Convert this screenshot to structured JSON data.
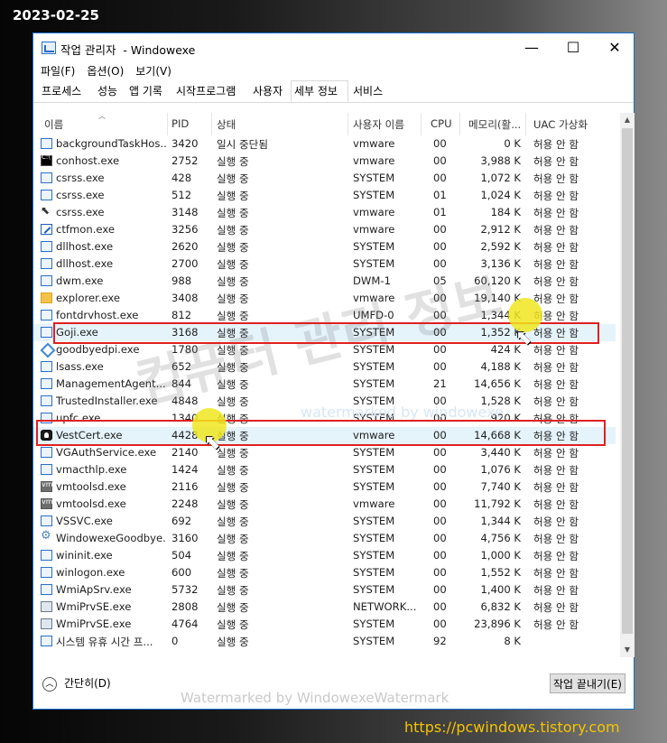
{
  "overlay": {
    "date": "2023-02-25",
    "site_url": "https://pcwindows.tistory.com",
    "watermark_bottom": "Watermarked by WindowexeWatermark",
    "watermark_center": "watermarked by windowexe",
    "watermark_big": "컴퓨터 관리 정보"
  },
  "window": {
    "title": "작업 관리자  - Windowexe",
    "controls": {
      "minimize": "—",
      "maximize": "☐",
      "close": "✕"
    }
  },
  "menu": [
    "파일(F)",
    "옵션(O)",
    "보기(V)"
  ],
  "tabs": [
    "프로세스",
    "성능",
    "앱 기록",
    "시작프로그램",
    "사용자",
    "세부 정보",
    "서비스"
  ],
  "active_tab": "세부 정보",
  "columns": [
    "이름",
    "PID",
    "상태",
    "사용자 이름",
    "CPU",
    "메모리(활...",
    "UAC 가상화"
  ],
  "rows": [
    {
      "icon": "box",
      "name": "backgroundTaskHos...",
      "pid": "3420",
      "status": "일시 중단됨",
      "user": "vmware",
      "cpu": "00",
      "mem": "0 K",
      "uac": "허용 안 함"
    },
    {
      "icon": "console",
      "name": "conhost.exe",
      "pid": "2752",
      "status": "실행 중",
      "user": "vmware",
      "cpu": "00",
      "mem": "3,988 K",
      "uac": "허용 안 함"
    },
    {
      "icon": "box",
      "name": "csrss.exe",
      "pid": "428",
      "status": "실행 중",
      "user": "SYSTEM",
      "cpu": "00",
      "mem": "1,072 K",
      "uac": "허용 안 함"
    },
    {
      "icon": "box",
      "name": "csrss.exe",
      "pid": "512",
      "status": "실행 중",
      "user": "SYSTEM",
      "cpu": "01",
      "mem": "1,024 K",
      "uac": "허용 안 함"
    },
    {
      "icon": "cursor",
      "name": "csrss.exe",
      "pid": "3148",
      "status": "실행 중",
      "user": "vmware",
      "cpu": "01",
      "mem": "184 K",
      "uac": "허용 안 함"
    },
    {
      "icon": "pen",
      "name": "ctfmon.exe",
      "pid": "3256",
      "status": "실행 중",
      "user": "vmware",
      "cpu": "00",
      "mem": "2,912 K",
      "uac": "허용 안 함"
    },
    {
      "icon": "box",
      "name": "dllhost.exe",
      "pid": "2620",
      "status": "실행 중",
      "user": "SYSTEM",
      "cpu": "00",
      "mem": "2,592 K",
      "uac": "허용 안 함"
    },
    {
      "icon": "box",
      "name": "dllhost.exe",
      "pid": "2700",
      "status": "실행 중",
      "user": "SYSTEM",
      "cpu": "00",
      "mem": "3,136 K",
      "uac": "허용 안 함"
    },
    {
      "icon": "box",
      "name": "dwm.exe",
      "pid": "988",
      "status": "실행 중",
      "user": "DWM-1",
      "cpu": "05",
      "mem": "60,120 K",
      "uac": "허용 안 함"
    },
    {
      "icon": "folder",
      "name": "explorer.exe",
      "pid": "3408",
      "status": "실행 중",
      "user": "vmware",
      "cpu": "00",
      "mem": "19,140 K",
      "uac": "허용 안 함"
    },
    {
      "icon": "box",
      "name": "fontdrvhost.exe",
      "pid": "812",
      "status": "실행 중",
      "user": "UMFD-0",
      "cpu": "00",
      "mem": "1,344 K",
      "uac": "허용 안 함"
    },
    {
      "icon": "box",
      "name": "Goji.exe",
      "pid": "3168",
      "status": "실행 중",
      "user": "SYSTEM",
      "cpu": "00",
      "mem": "1,352 K",
      "uac": "허용 안 함",
      "selected": true
    },
    {
      "icon": "diamond",
      "name": "goodbyedpi.exe",
      "pid": "1780",
      "status": "실행 중",
      "user": "SYSTEM",
      "cpu": "00",
      "mem": "424 K",
      "uac": "허용 안 함"
    },
    {
      "icon": "box",
      "name": "lsass.exe",
      "pid": "652",
      "status": "실행 중",
      "user": "SYSTEM",
      "cpu": "00",
      "mem": "4,188 K",
      "uac": "허용 안 함"
    },
    {
      "icon": "box",
      "name": "ManagementAgent...",
      "pid": "844",
      "status": "실행 중",
      "user": "SYSTEM",
      "cpu": "21",
      "mem": "14,656 K",
      "uac": "허용 안 함"
    },
    {
      "icon": "box",
      "name": "TrustedInstaller.exe",
      "pid": "4848",
      "status": "실행 중",
      "user": "SYSTEM",
      "cpu": "00",
      "mem": "1,528 K",
      "uac": "허용 안 함"
    },
    {
      "icon": "box",
      "name": "upfc.exe",
      "pid": "1340",
      "status": "실행 중",
      "user": "SYSTEM",
      "cpu": "00",
      "mem": "920 K",
      "uac": "허용 안 함"
    },
    {
      "icon": "vestcert",
      "name": "VestCert.exe",
      "pid": "4428",
      "status": "실행 중",
      "user": "vmware",
      "cpu": "00",
      "mem": "14,668 K",
      "uac": "허용 안 함",
      "selected": true
    },
    {
      "icon": "box",
      "name": "VGAuthService.exe",
      "pid": "2140",
      "status": "실행 중",
      "user": "SYSTEM",
      "cpu": "00",
      "mem": "3,440 K",
      "uac": "허용 안 함"
    },
    {
      "icon": "box",
      "name": "vmacthlp.exe",
      "pid": "1424",
      "status": "실행 중",
      "user": "SYSTEM",
      "cpu": "00",
      "mem": "1,076 K",
      "uac": "허용 안 함"
    },
    {
      "icon": "vm",
      "name": "vmtoolsd.exe",
      "pid": "2116",
      "status": "실행 중",
      "user": "SYSTEM",
      "cpu": "00",
      "mem": "7,740 K",
      "uac": "허용 안 함"
    },
    {
      "icon": "vm",
      "name": "vmtoolsd.exe",
      "pid": "2248",
      "status": "실행 중",
      "user": "vmware",
      "cpu": "00",
      "mem": "11,792 K",
      "uac": "허용 안 함"
    },
    {
      "icon": "box",
      "name": "VSSVC.exe",
      "pid": "692",
      "status": "실행 중",
      "user": "SYSTEM",
      "cpu": "00",
      "mem": "1,344 K",
      "uac": "허용 안 함"
    },
    {
      "icon": "gear",
      "name": "WindowexeGoodbye...",
      "pid": "3160",
      "status": "실행 중",
      "user": "SYSTEM",
      "cpu": "00",
      "mem": "4,756 K",
      "uac": "허용 안 함"
    },
    {
      "icon": "box",
      "name": "wininit.exe",
      "pid": "504",
      "status": "실행 중",
      "user": "SYSTEM",
      "cpu": "00",
      "mem": "1,000 K",
      "uac": "허용 안 함"
    },
    {
      "icon": "box",
      "name": "winlogon.exe",
      "pid": "600",
      "status": "실행 중",
      "user": "SYSTEM",
      "cpu": "00",
      "mem": "1,552 K",
      "uac": "허용 안 함"
    },
    {
      "icon": "box",
      "name": "WmiApSrv.exe",
      "pid": "5732",
      "status": "실행 중",
      "user": "SYSTEM",
      "cpu": "00",
      "mem": "1,400 K",
      "uac": "허용 안 함"
    },
    {
      "icon": "service",
      "name": "WmiPrvSE.exe",
      "pid": "2808",
      "status": "실행 중",
      "user": "NETWORK...",
      "cpu": "00",
      "mem": "6,832 K",
      "uac": "허용 안 함"
    },
    {
      "icon": "service",
      "name": "WmiPrvSE.exe",
      "pid": "4764",
      "status": "실행 중",
      "user": "SYSTEM",
      "cpu": "00",
      "mem": "23,896 K",
      "uac": "허용 안 함"
    },
    {
      "icon": "box",
      "name": "시스템 유휴 시간 프...",
      "pid": "0",
      "status": "실행 중",
      "user": "SYSTEM",
      "cpu": "92",
      "mem": "8 K",
      "uac": ""
    }
  ],
  "footer": {
    "collapse_label": "간단히(D)",
    "end_task_label": "작업 끝내기(E)"
  },
  "colors": {
    "highlight_box": "#e02020",
    "selection_bg": "#e5f3fb",
    "click_marker": "#f0e61e",
    "window_border": "#1570d4"
  }
}
